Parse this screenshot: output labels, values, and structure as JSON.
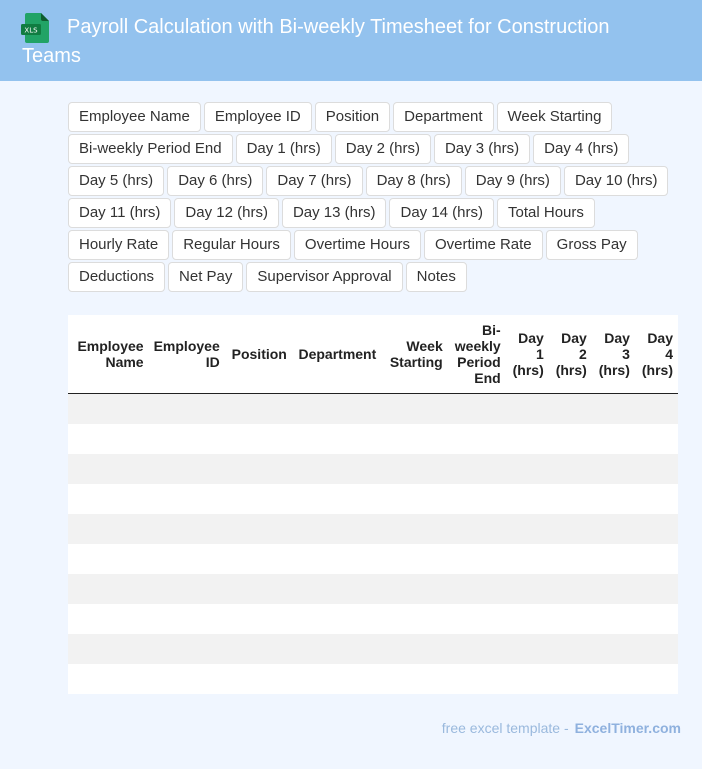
{
  "header": {
    "icon_label": "XLS",
    "title": "Payroll Calculation with Bi-weekly Timesheet for Construction Teams"
  },
  "chips": [
    "Employee Name",
    "Employee ID",
    "Position",
    "Department",
    "Week Starting",
    "Bi-weekly Period End",
    "Day 1 (hrs)",
    "Day 2 (hrs)",
    "Day 3 (hrs)",
    "Day 4 (hrs)",
    "Day 5 (hrs)",
    "Day 6 (hrs)",
    "Day 7 (hrs)",
    "Day 8 (hrs)",
    "Day 9 (hrs)",
    "Day 10 (hrs)",
    "Day 11 (hrs)",
    "Day 12 (hrs)",
    "Day 13 (hrs)",
    "Day 14 (hrs)",
    "Total Hours",
    "Hourly Rate",
    "Regular Hours",
    "Overtime Hours",
    "Overtime Rate",
    "Gross Pay",
    "Deductions",
    "Net Pay",
    "Supervisor Approval",
    "Notes"
  ],
  "table": {
    "columns": [
      "Employee Name",
      "Employee ID",
      "Position",
      "Department",
      "Week Starting",
      "Bi-weekly Period End",
      "Day 1 (hrs)",
      "Day 2 (hrs)",
      "Day 3 (hrs)",
      "Day 4 (hrs)"
    ],
    "row_count": 10
  },
  "footer": {
    "text": "free excel template -",
    "brand": "ExcelTimer.com"
  },
  "colors": {
    "header_bg": "#93c2ee",
    "page_bg": "#f0f6ff",
    "icon_green": "#1f7a45",
    "row_stripe": "#f2f2f2"
  }
}
